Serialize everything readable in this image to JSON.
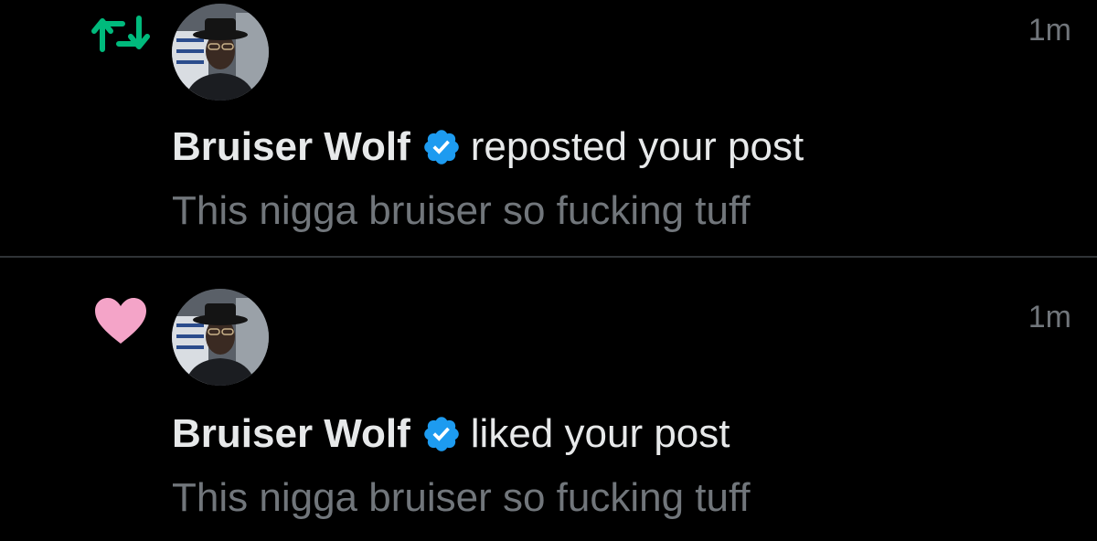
{
  "colors": {
    "background": "#000000",
    "divider": "#2f3336",
    "primary_text": "#e7e9ea",
    "secondary_text": "#71767b",
    "repost": "#00ba7c",
    "like": "#f4a4c8",
    "verified": "#1d9bf0"
  },
  "notifications": [
    {
      "type_icon": "repost-icon",
      "time": "1m",
      "user_name": "Bruiser Wolf",
      "verified_icon": "verified-badge-icon",
      "action_text": "reposted your post",
      "post_text": "This nigga bruiser so fucking tuff"
    },
    {
      "type_icon": "heart-icon",
      "time": "1m",
      "user_name": "Bruiser Wolf",
      "verified_icon": "verified-badge-icon",
      "action_text": "liked your post",
      "post_text": "This nigga bruiser so fucking tuff"
    }
  ]
}
